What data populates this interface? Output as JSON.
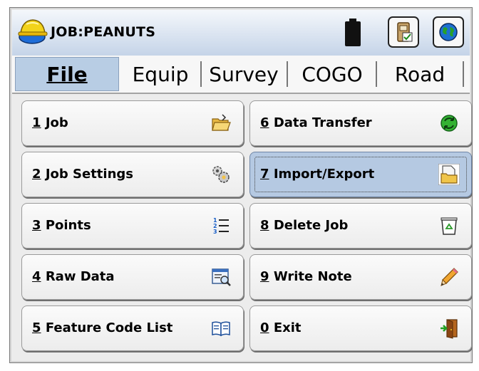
{
  "app": {
    "title": "JOB:PEANUTS"
  },
  "colors": {
    "tab_active": "#b8cde4",
    "button_selected": "#b5c9e2",
    "titlebar": "#c5d4e8"
  },
  "tabs": [
    {
      "label": "File",
      "active": true
    },
    {
      "label": "Equip",
      "active": false
    },
    {
      "label": "Survey",
      "active": false
    },
    {
      "label": "COGO",
      "active": false
    },
    {
      "label": "Road",
      "active": false
    }
  ],
  "menu": [
    {
      "num": "1",
      "text": "Job",
      "icon": "open-folder-icon"
    },
    {
      "num": "2",
      "text": "Job Settings",
      "icon": "settings-gears-icon"
    },
    {
      "num": "3",
      "text": "Points",
      "icon": "numbered-list-icon"
    },
    {
      "num": "4",
      "text": "Raw Data",
      "icon": "raw-data-window-icon"
    },
    {
      "num": "5",
      "text": "Feature Code List",
      "icon": "book-icon"
    },
    {
      "num": "6",
      "text": "Data Transfer",
      "icon": "transfer-arrows-icon"
    },
    {
      "num": "7",
      "text": "Import/Export",
      "icon": "import-export-folder-icon",
      "selected": true
    },
    {
      "num": "8",
      "text": "Delete Job",
      "icon": "recycle-bin-icon"
    },
    {
      "num": "9",
      "text": "Write Note",
      "icon": "pencil-icon"
    },
    {
      "num": "0",
      "text": "Exit",
      "icon": "exit-door-icon"
    }
  ]
}
